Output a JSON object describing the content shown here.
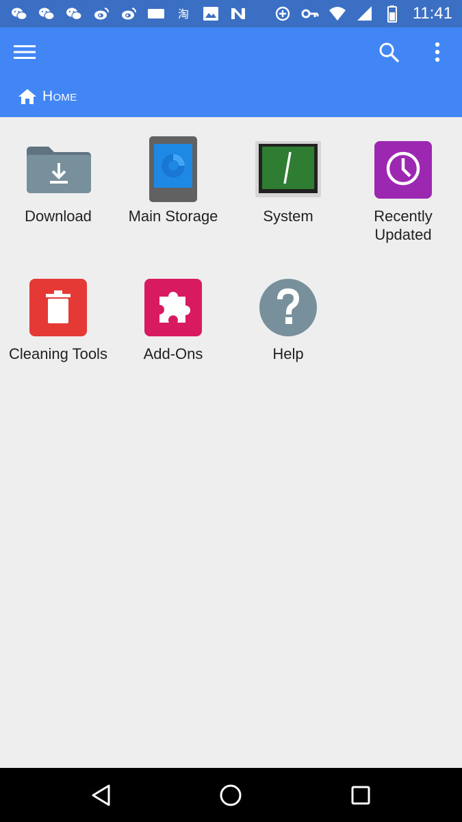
{
  "status_bar": {
    "time": "11:41",
    "left_icons": [
      "wechat-icon",
      "wechat-icon",
      "wechat-icon",
      "weibo-icon",
      "weibo-icon",
      "keyboard-icon",
      "taobao-icon",
      "image-icon",
      "n-icon"
    ],
    "right_icons": [
      "data-saver-icon",
      "vpn-key-icon",
      "wifi-icon",
      "cellular-icon",
      "battery-icon"
    ]
  },
  "app_bar": {
    "color": "#4285f4",
    "breadcrumb": "Home"
  },
  "tiles": [
    {
      "label": "Download",
      "icon": "download-folder-icon"
    },
    {
      "label": "Main Storage",
      "icon": "storage-icon"
    },
    {
      "label": "System",
      "icon": "terminal-icon"
    },
    {
      "label": "Recently\nUpdated",
      "icon": "clock-icon"
    },
    {
      "label": "Cleaning Tools",
      "icon": "trash-icon"
    },
    {
      "label": "Add-Ons",
      "icon": "puzzle-icon"
    },
    {
      "label": "Help",
      "icon": "help-icon"
    }
  ],
  "nav_bar": {
    "buttons": [
      "back-icon",
      "home-circle-icon",
      "recents-icon"
    ]
  }
}
